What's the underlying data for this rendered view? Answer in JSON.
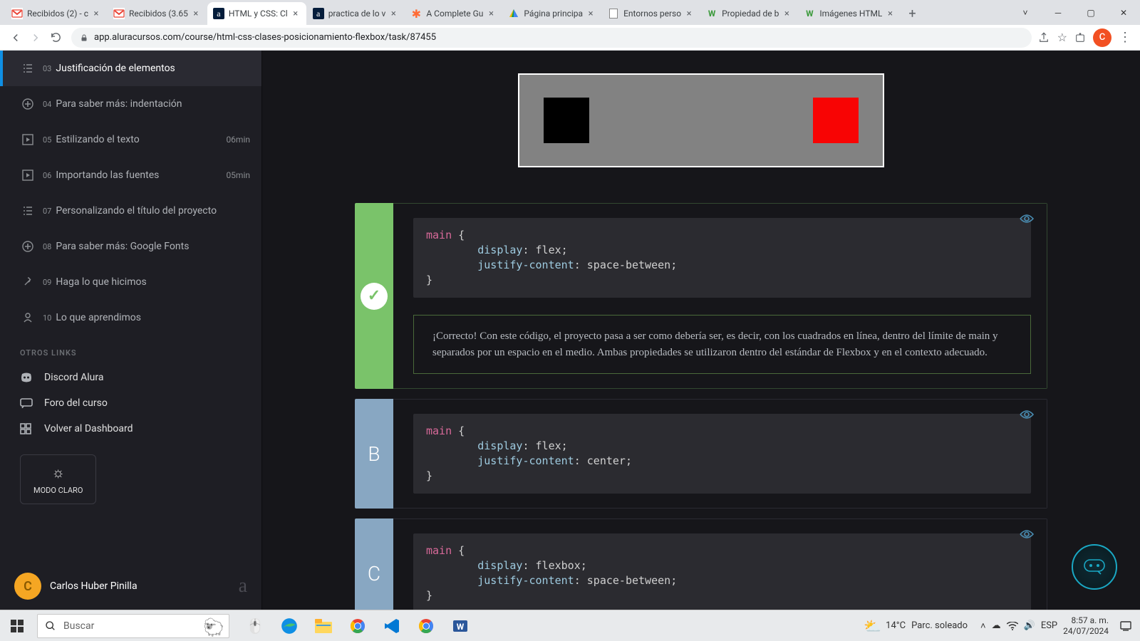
{
  "browser": {
    "tabs": [
      {
        "title": "Recibidos (2) - c",
        "favicon": "M"
      },
      {
        "title": "Recibidos (3.65",
        "favicon": "M"
      },
      {
        "title": "HTML y CSS: Cl",
        "favicon": "a",
        "active": true
      },
      {
        "title": "practica de lo v",
        "favicon": "a"
      },
      {
        "title": "A Complete Gu",
        "favicon": "*"
      },
      {
        "title": "Página principa",
        "favicon": "▲"
      },
      {
        "title": "Entornos perso",
        "favicon": "▯"
      },
      {
        "title": "Propiedad de b",
        "favicon": "W"
      },
      {
        "title": "Imágenes HTML",
        "favicon": "W"
      }
    ],
    "url": "app.aluracursos.com/course/html-css-clases-posicionamiento-flexbox/task/87455",
    "profile_letter": "C"
  },
  "sidebar": {
    "items": [
      {
        "num": "03",
        "label": "Justificación de elementos",
        "icon": "list",
        "active": true
      },
      {
        "num": "04",
        "label": "Para saber más: indentación",
        "icon": "plus"
      },
      {
        "num": "05",
        "label": "Estilizando el texto",
        "icon": "play",
        "dur": "06min"
      },
      {
        "num": "06",
        "label": "Importando las fuentes",
        "icon": "play",
        "dur": "05min"
      },
      {
        "num": "07",
        "label": "Personalizando el título del proyecto",
        "icon": "list"
      },
      {
        "num": "08",
        "label": "Para saber más: Google Fonts",
        "icon": "plus"
      },
      {
        "num": "09",
        "label": "Haga lo que hicimos",
        "icon": "tool"
      },
      {
        "num": "10",
        "label": "Lo que aprendimos",
        "icon": "person"
      }
    ],
    "links_title": "OTROS LINKS",
    "links": [
      {
        "label": "Discord Alura",
        "icon": "discord"
      },
      {
        "label": "Foro del curso",
        "icon": "forum"
      },
      {
        "label": "Volver al Dashboard",
        "icon": "dash"
      }
    ],
    "theme_label": "MODO CLARO",
    "user_name": "Carlos Huber Pinilla",
    "user_initial": "C"
  },
  "quiz": {
    "answers": [
      {
        "letter": "check",
        "state": "correct",
        "selector": "main",
        "lines": [
          {
            "prop": "display",
            "val": "flex"
          },
          {
            "prop": "justify-content",
            "val": "space-between"
          }
        ],
        "feedback": "¡Correcto! Con este código, el proyecto pasa a ser como debería ser, es decir, con los cuadrados en línea, dentro del límite de main y separados por un espacio en el medio. Ambas propiedades se utilizaron dentro del estándar de Flexbox y en el contexto adecuado."
      },
      {
        "letter": "B",
        "state": "normal",
        "selector": "main",
        "lines": [
          {
            "prop": "display",
            "val": "flex"
          },
          {
            "prop": "justify-content",
            "val": "center"
          }
        ]
      },
      {
        "letter": "C",
        "state": "normal",
        "selector": "main",
        "lines": [
          {
            "prop": "display",
            "val": "flexbox"
          },
          {
            "prop": "justify-content",
            "val": "space-between"
          }
        ]
      }
    ]
  },
  "taskbar": {
    "search_placeholder": "Buscar",
    "weather_temp": "14°C",
    "weather_desc": "Parc. soleado",
    "lang": "ESP",
    "time": "8:57 a. m.",
    "date": "24/07/2024"
  }
}
